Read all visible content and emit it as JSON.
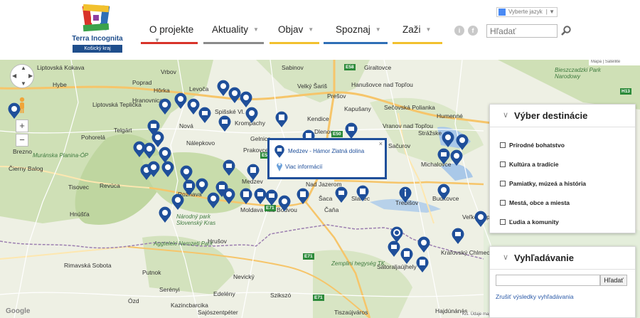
{
  "header": {
    "logo": {
      "name": "Terra Incognita",
      "subtitle": "Košický kraj"
    },
    "nav": [
      {
        "label": "O projekte"
      },
      {
        "label": "Aktuality"
      },
      {
        "label": "Objav"
      },
      {
        "label": "Spoznaj"
      },
      {
        "label": "Zaži"
      }
    ],
    "social": [
      {
        "icon": "instagram-icon",
        "glyph": "i"
      },
      {
        "icon": "facebook-icon",
        "glyph": "f"
      }
    ],
    "search": {
      "placeholder": "Hľadať"
    },
    "language": {
      "label": "Vyberte jazyk"
    }
  },
  "map": {
    "towns": [
      {
        "label": "Liptovská Kokava"
      },
      {
        "label": "Hybe"
      },
      {
        "label": "Poprad"
      },
      {
        "label": "Vrbov"
      },
      {
        "label": "Sabinov"
      },
      {
        "label": "Hanušovce nad Topľou"
      },
      {
        "label": "Giraltovce"
      },
      {
        "label": "Hôrka"
      },
      {
        "label": "Levoča"
      },
      {
        "label": "Liptovská Teplička"
      },
      {
        "label": "Hranovnica"
      },
      {
        "label": "Nová"
      },
      {
        "label": "Spišské Vl."
      },
      {
        "label": "Krompachy"
      },
      {
        "label": "Velký Šariš"
      },
      {
        "label": "Prešov"
      },
      {
        "label": "Kapušany"
      },
      {
        "label": "Kendice"
      },
      {
        "label": "Vranov nad Topľou"
      },
      {
        "label": "Sečovská Polianka"
      },
      {
        "label": "Humenné"
      },
      {
        "label": "Pohorelá"
      },
      {
        "label": "Telgárt"
      },
      {
        "label": "Nálepkovo"
      },
      {
        "label": "Gelnica"
      },
      {
        "label": "Prakovce"
      },
      {
        "label": "Dlenov"
      },
      {
        "label": "Strážske"
      },
      {
        "label": "Sačurov"
      },
      {
        "label": "Brezno"
      },
      {
        "label": "Čierny Balog"
      },
      {
        "label": "Michalovce"
      },
      {
        "label": "Tisovec"
      },
      {
        "label": "Revúca"
      },
      {
        "label": "Medzev"
      },
      {
        "label": "Nad Jazerom"
      },
      {
        "label": "Šaca"
      },
      {
        "label": "Slanec"
      },
      {
        "label": "Trebišov"
      },
      {
        "label": "Budkovce"
      },
      {
        "label": "Hnúšťa"
      },
      {
        "label": "Rožňava"
      },
      {
        "label": "Moldava nad Bodvou"
      },
      {
        "label": "Čaňa"
      },
      {
        "label": "Hrušov"
      },
      {
        "label": "Veľké Kapušany"
      },
      {
        "label": "Rimavská Sobota"
      },
      {
        "label": "Putnok"
      },
      {
        "label": "Sátoraljaújhely"
      },
      {
        "label": "Kráľovský Chlmec"
      },
      {
        "label": "Serényi"
      },
      {
        "label": "Sajószentpéter"
      },
      {
        "label": "Edelény"
      },
      {
        "label": "Ózd"
      },
      {
        "label": "Kazincbarcika"
      },
      {
        "label": "Nevický"
      },
      {
        "label": "Szikszó"
      },
      {
        "label": "Tiszaújváros"
      },
      {
        "label": "Hajdúnánás"
      }
    ],
    "parks": [
      {
        "label": "Muránska Planina-ÓP"
      },
      {
        "label": "Národný park Slovenský Kras"
      },
      {
        "label": "Aggteleki Nemzeti Park"
      },
      {
        "label": "Zemplini hegység TK"
      },
      {
        "label": "Bieszczadzki Park Narodowy"
      }
    ],
    "roads": [
      {
        "label": "E50"
      },
      {
        "label": "E71"
      },
      {
        "label": "E71"
      },
      {
        "label": "E58"
      },
      {
        "label": "H13"
      },
      {
        "label": "E71"
      },
      {
        "label": "E50"
      }
    ],
    "controls": {
      "map_type": "Mapa | Satellite",
      "zoom_in": "+",
      "zoom_out": "−"
    },
    "footer": {
      "text": "Kis. Údaje mapy ©2014 Google · Zmluvné podmienky · Nahlásiť chybu mapy"
    },
    "google": "Google"
  },
  "info_window": {
    "title": "Medzev - Hámor Zlatná dolina",
    "link": "Viac informácií",
    "close": "×"
  },
  "destinations_panel": {
    "title": "Výber destinácie",
    "options": [
      {
        "label": "Prírodné bohatstvo"
      },
      {
        "label": "Kultúra a tradície"
      },
      {
        "label": "Pamiatky, múzeá a história"
      },
      {
        "label": "Mestá, obce a miesta"
      },
      {
        "label": "Ľudia a komunity"
      }
    ]
  },
  "search_panel": {
    "title": "Vyhľadávanie",
    "button": "Hľadať",
    "clear": "Zrušiť výsledky vyhľadávania"
  },
  "colors": {
    "brand_blue": "#1f4f9a",
    "red": "#d8332a",
    "yellow": "#f2c12e",
    "gray": "#8a8a8a"
  }
}
